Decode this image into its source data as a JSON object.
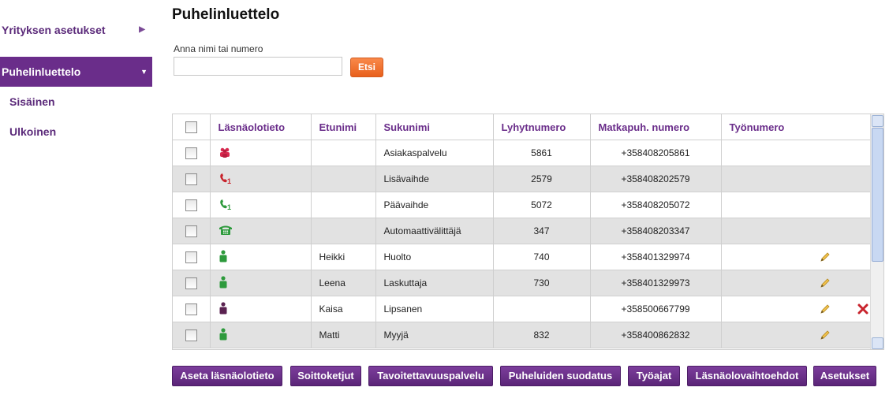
{
  "sidebar": {
    "company_settings": "Yrityksen asetukset",
    "active_item": "Puhelinluettelo",
    "sub_items": [
      "Sisäinen",
      "Ulkoinen"
    ]
  },
  "main": {
    "title": "Puhelinluettelo",
    "search": {
      "label": "Anna nimi tai numero",
      "value": "",
      "placeholder": "",
      "button": "Etsi"
    },
    "table": {
      "headers": [
        "Läsnäolotieto",
        "Etunimi",
        "Sukunimi",
        "Lyhytnumero",
        "Matkapuh. numero",
        "Työnumero"
      ],
      "rows": [
        {
          "presence_icon": "group-icon",
          "presence_color": "#d8284e",
          "first": "",
          "last": "Asiakaspalvelu",
          "short": "5861",
          "mobile": "+358408205861",
          "work": ""
        },
        {
          "presence_icon": "phone-busy-icon",
          "presence_color": "#c8232c",
          "first": "",
          "last": "Lisävaihde",
          "short": "2579",
          "mobile": "+358408202579",
          "work": ""
        },
        {
          "presence_icon": "phone-available-icon",
          "presence_color": "#2d9a3c",
          "first": "",
          "last": "Päävaihde",
          "short": "5072",
          "mobile": "+358408205072",
          "work": ""
        },
        {
          "presence_icon": "telephone-icon",
          "presence_color": "#2d9a3c",
          "first": "",
          "last": "Automaattivälittäjä",
          "short": "347",
          "mobile": "+358408203347",
          "work": ""
        },
        {
          "presence_icon": "person-icon",
          "presence_color": "#2d9a3c",
          "first": "Heikki",
          "last": "Huolto",
          "short": "740",
          "mobile": "+358401329974",
          "work": ""
        },
        {
          "presence_icon": "person-icon",
          "presence_color": "#2d9a3c",
          "first": "Leena",
          "last": "Laskuttaja",
          "short": "730",
          "mobile": "+358401329973",
          "work": ""
        },
        {
          "presence_icon": "person-icon",
          "presence_color": "#5a2250",
          "first": "Kaisa",
          "last": "Lipsanen",
          "short": "",
          "mobile": "+358500667799",
          "work": ""
        },
        {
          "presence_icon": "person-icon",
          "presence_color": "#2d9a3c",
          "first": "Matti",
          "last": "Myyjä",
          "short": "832",
          "mobile": "+358400862832",
          "work": ""
        }
      ]
    }
  },
  "buttons": [
    "Aseta läsnäolotieto",
    "Soittoketjut",
    "Tavoitettavuuspalvelu",
    "Puheluiden suodatus",
    "Työajat",
    "Läsnäolovaihtoehdot",
    "Asetukset"
  ]
}
